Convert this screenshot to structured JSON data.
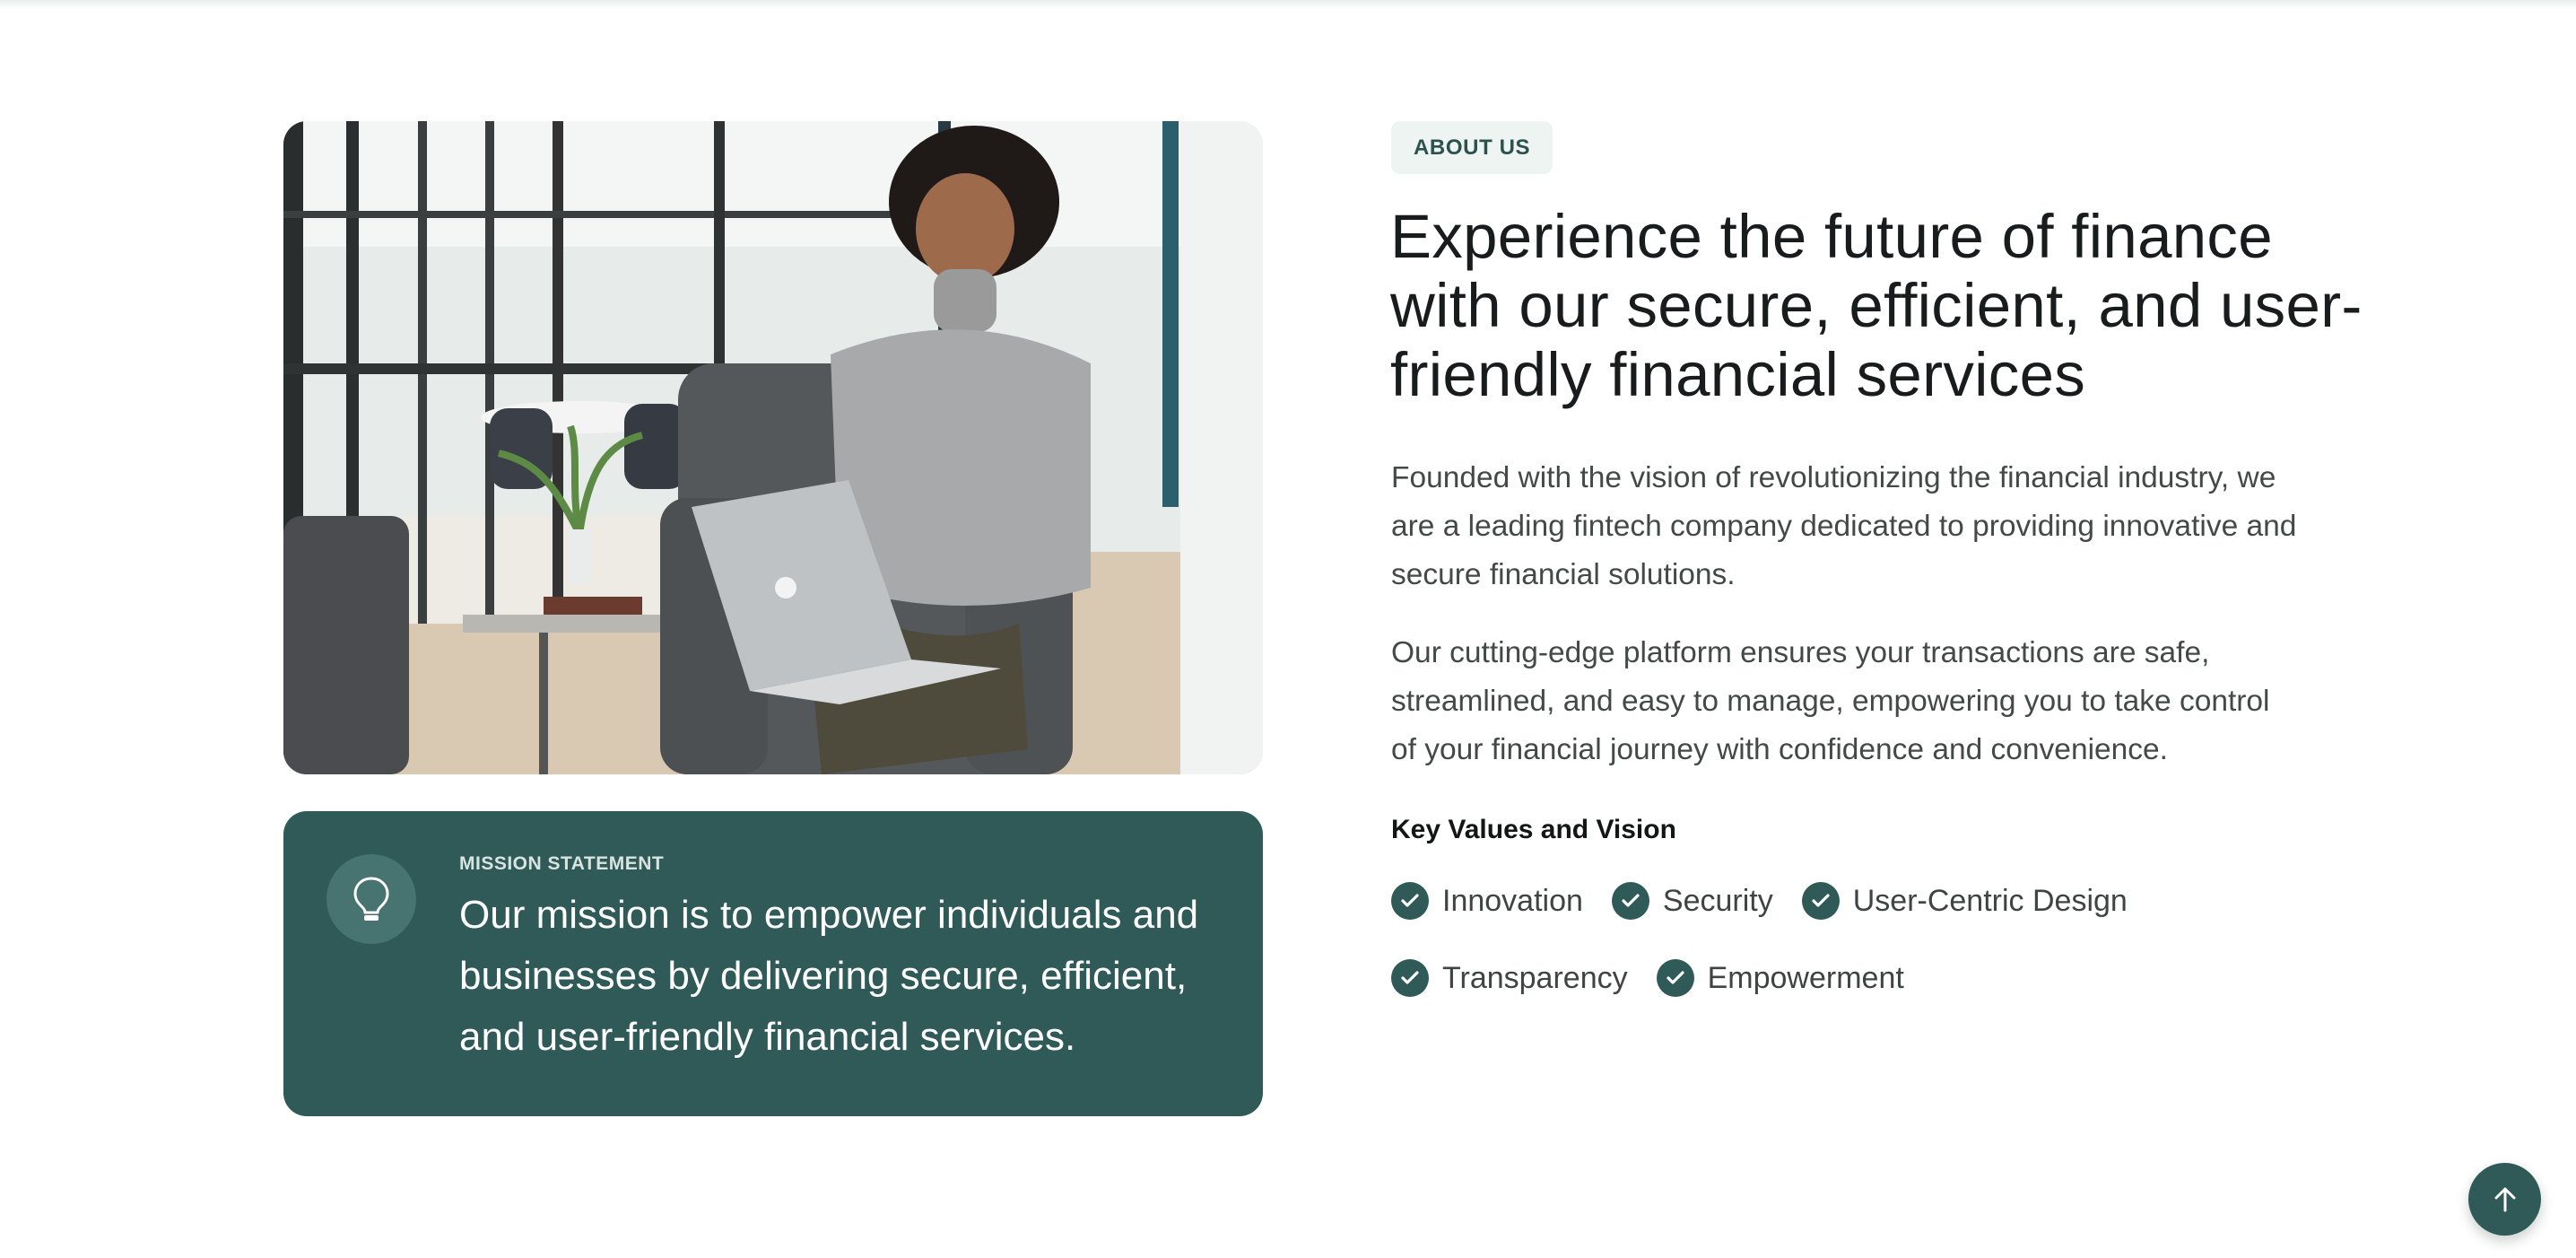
{
  "about": {
    "badge": "ABOUT US",
    "headline": "Experience the future of finance with our secure, efficient, and user-friendly financial services",
    "paragraphs": [
      "Founded with the vision of revolutionizing the financial industry, we are a leading fintech company dedicated to providing innovative and secure financial solutions.",
      "Our cutting-edge platform ensures your transactions are safe, streamlined, and easy to manage, empowering you to take control of your financial journey with confidence and convenience."
    ],
    "values_title": "Key Values and Vision",
    "values": [
      "Innovation",
      "Security",
      "User-Centric Design",
      "Transparency",
      "Empowerment"
    ]
  },
  "mission": {
    "label": "MISSION STATEMENT",
    "text": "Our mission is to empower individuals and businesses by delivering secure, efficient, and user-friendly financial services.",
    "icon": "lightbulb-icon"
  },
  "photo": {
    "icon": "office-photo"
  },
  "scroll_top": {
    "icon": "arrow-up-icon"
  },
  "colors": {
    "accent": "#2f5a57",
    "badge_bg": "#edf4f1",
    "headline": "#181c1c",
    "body_text": "#434947"
  }
}
